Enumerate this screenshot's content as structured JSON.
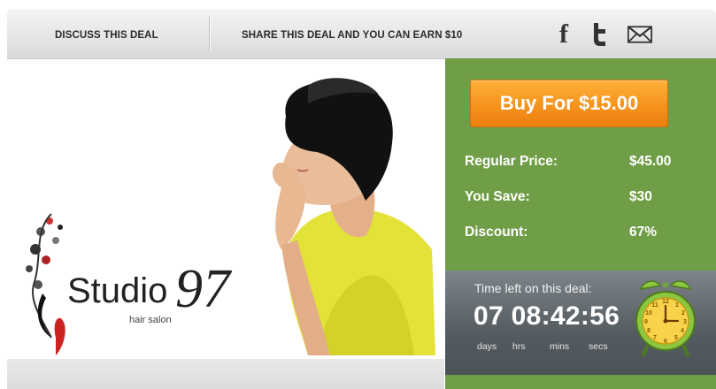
{
  "nav": {
    "discuss_label": "DISCUSS THIS DEAL",
    "share_label": "SHARE THIS DEAL AND YOU CAN EARN $10",
    "social_icons": [
      "facebook-icon",
      "twitter-icon",
      "email-icon"
    ]
  },
  "deal_image": {
    "brand": "Studio",
    "brand_number": "97",
    "tagline": "hair salon"
  },
  "pricing": {
    "buy_label": "Buy For $15.00",
    "regular_label": "Regular Price:",
    "regular_value": "$45.00",
    "save_label": "You Save:",
    "save_value": "$30",
    "discount_label": "Discount:",
    "discount_value": "67%"
  },
  "timer": {
    "label": "Time left on this deal:",
    "countdown": "07 08:42:56",
    "units": {
      "days": "days",
      "hrs": "hrs",
      "mins": "mins",
      "secs": "secs"
    }
  },
  "colors": {
    "panel_green": "#6f9e46",
    "button_orange": "#f6931d",
    "timer_gray": "#5b6267"
  }
}
